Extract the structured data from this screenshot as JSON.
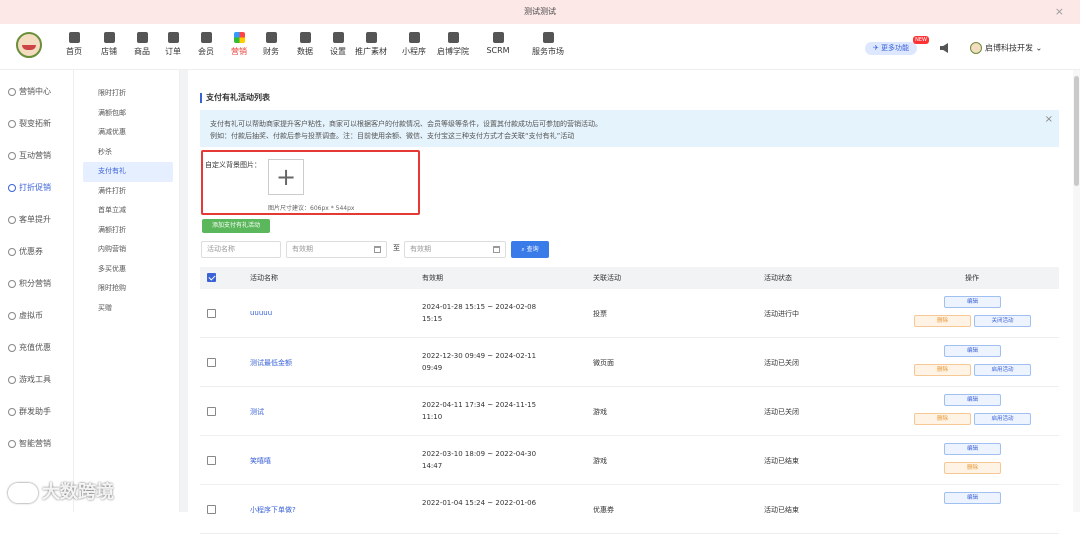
{
  "window": {
    "title": "测试测试"
  },
  "topnav": {
    "items": [
      {
        "label": "首页",
        "icon": "home-icon"
      },
      {
        "label": "店铺",
        "icon": "store-icon"
      },
      {
        "label": "商品",
        "icon": "goods-icon"
      },
      {
        "label": "订单",
        "icon": "order-icon"
      },
      {
        "label": "会员",
        "icon": "member-icon"
      },
      {
        "label": "营销",
        "icon": "marketing-icon"
      },
      {
        "label": "财务",
        "icon": "finance-icon"
      },
      {
        "label": "数据",
        "icon": "data-icon"
      },
      {
        "label": "设置",
        "icon": "settings-icon"
      },
      {
        "label": "推广素材",
        "icon": "share-icon"
      },
      {
        "label": "小程序",
        "icon": "miniprogram-icon"
      },
      {
        "label": "启博学院",
        "icon": "academy-icon"
      },
      {
        "label": "SCRM",
        "icon": "scrm-icon"
      },
      {
        "label": "服务市场",
        "icon": "market-icon"
      }
    ],
    "active": "营销",
    "more_features": "更多功能",
    "new_badge": "NEW",
    "user": "启博科技开发"
  },
  "sidebar1": {
    "items": [
      "营销中心",
      "裂变拓新",
      "互动营销",
      "打折促销",
      "客单提升",
      "优惠券",
      "积分营销",
      "虚拟币",
      "充值优惠",
      "游戏工具",
      "群发助手",
      "智能营销"
    ],
    "active": "打折促销"
  },
  "sidebar2": {
    "items": [
      "限时打折",
      "满额包邮",
      "满减优惠",
      "秒杀",
      "支付有礼",
      "满件打折",
      "首单立减",
      "满额打折",
      "内购营销",
      "多买优惠",
      "限时抢购",
      "买赠"
    ],
    "active": "支付有礼"
  },
  "page": {
    "title": "支付有礼活动列表",
    "notice_line1": "支付有礼可以帮助商家提升客户粘性，商家可以根据客户的付款情况、会员等级等条件，设置其付款成功后可参加的营销活动。",
    "notice_line2": "例如：付款后抽奖、付款后参与投票调查。注：目前使用余额、微信、支付宝这三种支付方式才会关联“支付有礼”活动",
    "bg_label": "自定义背景图片：",
    "upload_plus": "+",
    "size_hint": "图片尺寸建议：606px * 544px",
    "add_button": "添加支付有礼活动",
    "filter": {
      "name_placeholder": "活动名称",
      "date_from_placeholder": "有效期",
      "date_to_placeholder": "有效期",
      "to_label": "至",
      "query_button": "查询"
    },
    "table": {
      "headers": [
        "活动名称",
        "有效期",
        "关联活动",
        "活动状态",
        "操作"
      ],
      "rows": [
        {
          "name": "uuuuu",
          "period_1": "2024-01-28 15:15 ~ 2024-02-08",
          "period_2": "15:15",
          "related": "投票",
          "status": "活动进行中",
          "ops": [
            "编辑",
            "删除",
            "关闭活动"
          ]
        },
        {
          "name": "测试最低金额",
          "period_1": "2022-12-30 09:49 ~ 2024-02-11",
          "period_2": "09:49",
          "related": "微页面",
          "status": "活动已关闭",
          "ops": [
            "编辑",
            "删除",
            "启用活动"
          ]
        },
        {
          "name": "测试",
          "period_1": "2022-04-11 17:34 ~ 2024-11-15",
          "period_2": "11:10",
          "related": "游戏",
          "status": "活动已关闭",
          "ops": [
            "编辑",
            "删除",
            "启用活动"
          ]
        },
        {
          "name": "笑嘻嘻",
          "period_1": "2022-03-10 18:09 ~ 2022-04-30",
          "period_2": "14:47",
          "related": "游戏",
          "status": "活动已结束",
          "ops": [
            "编辑",
            "删除"
          ]
        },
        {
          "name": "小程序下单做?",
          "period_1": "2022-01-04 15:24 ~ 2022-01-06",
          "period_2": "",
          "related": "优惠券",
          "status": "活动已结束",
          "ops": [
            "编辑"
          ]
        }
      ]
    }
  },
  "watermark": "大数跨境"
}
